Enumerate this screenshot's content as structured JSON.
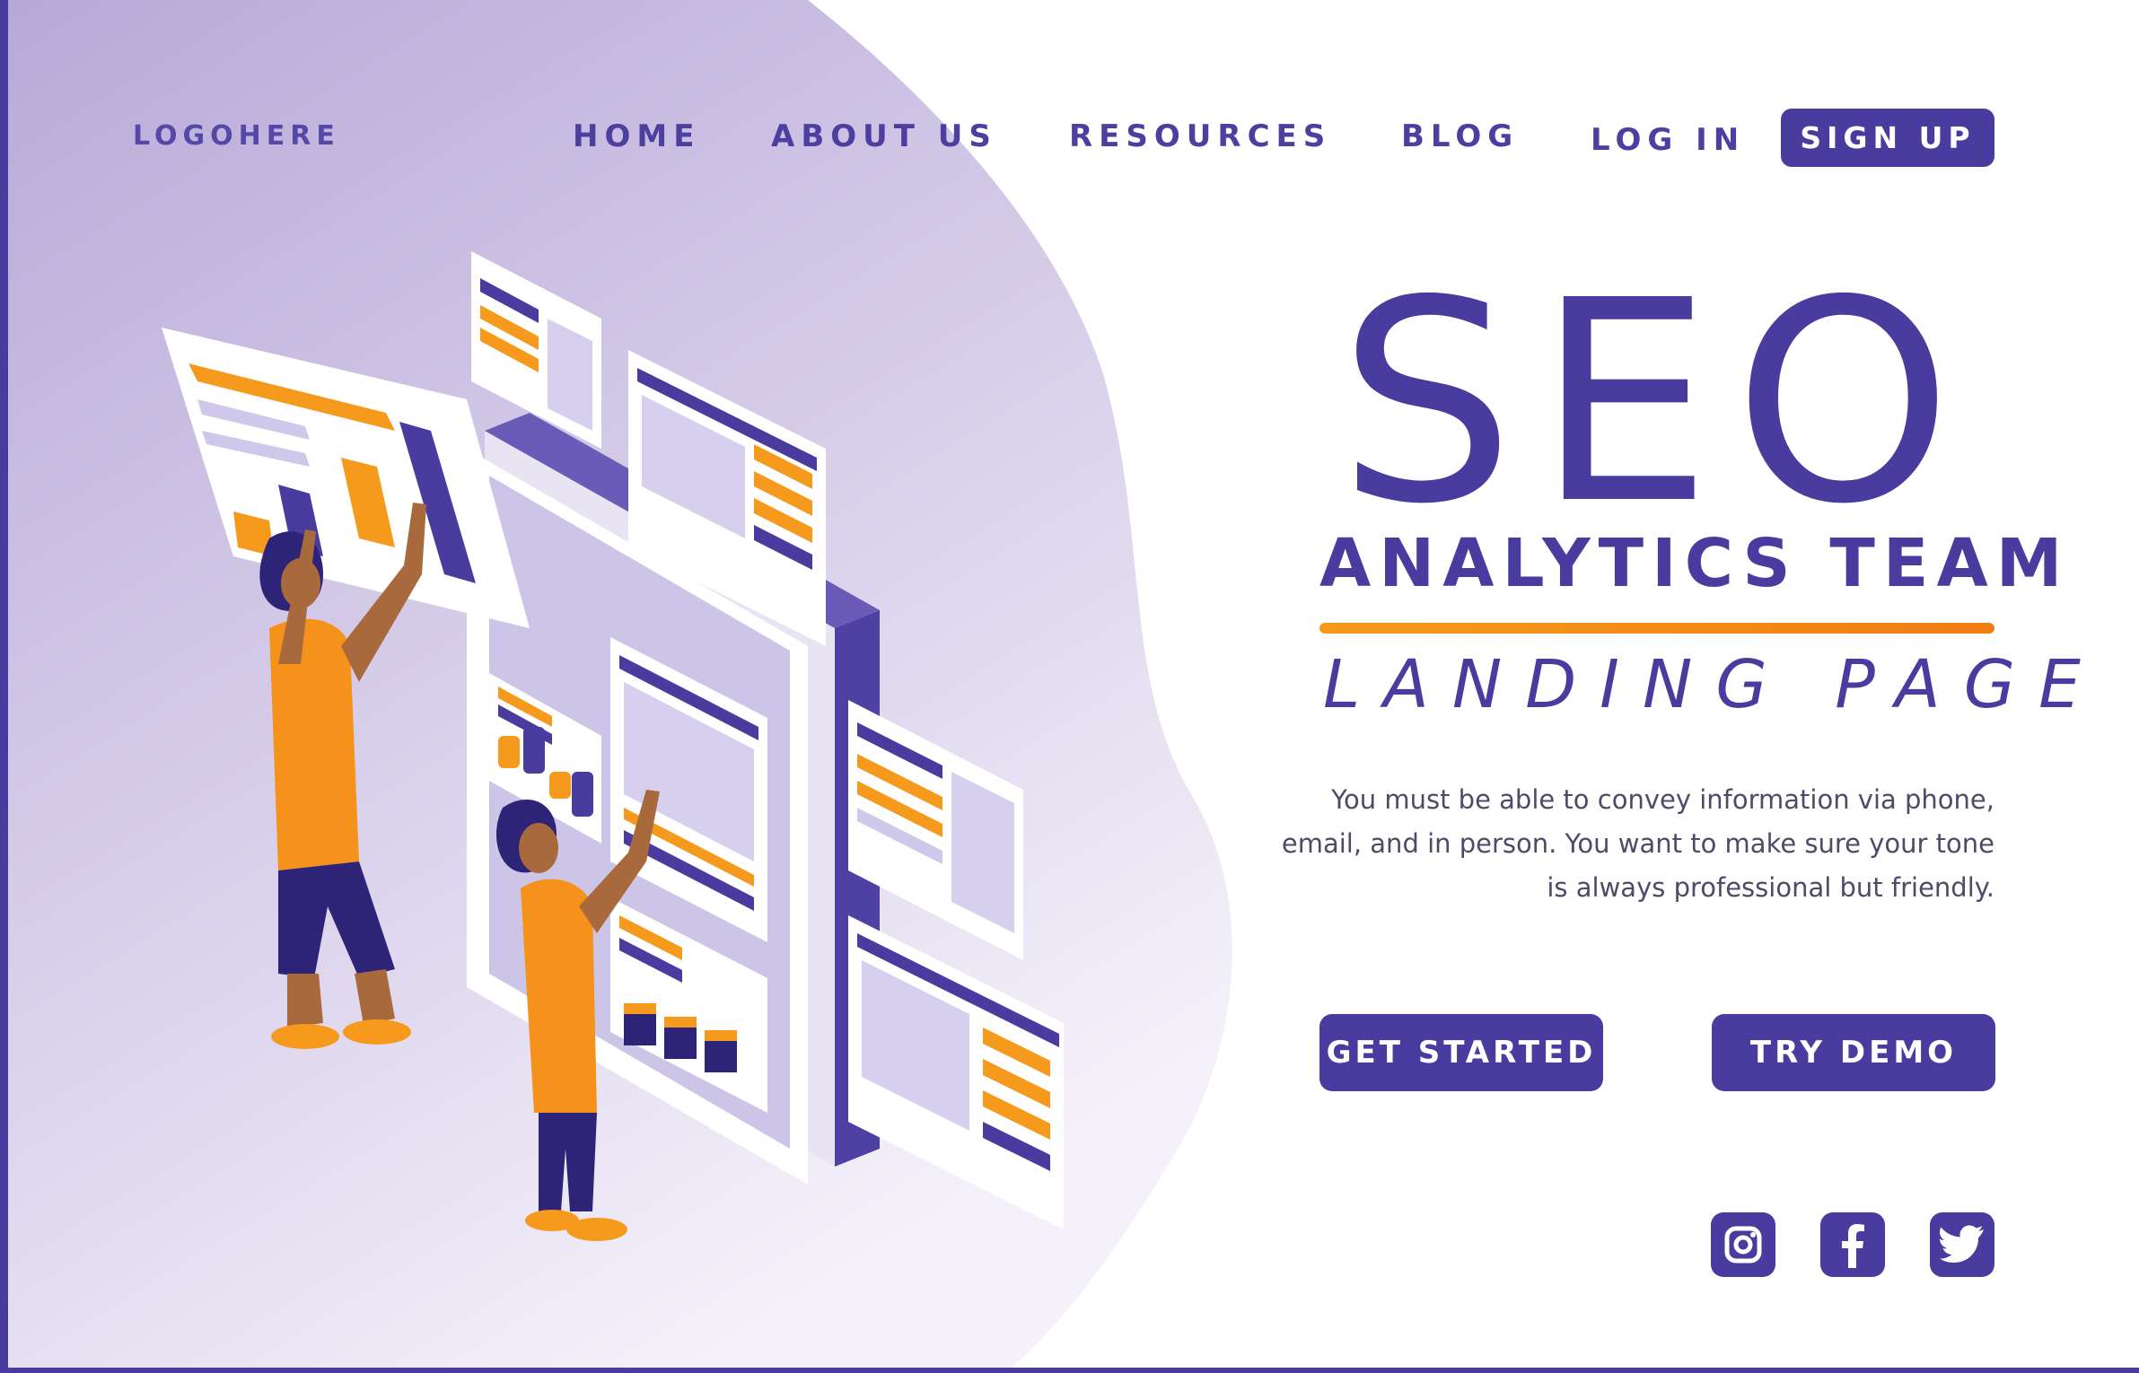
{
  "nav": {
    "logo": "LOGOHERE",
    "home": "HOME",
    "about": "ABOUT US",
    "resources": "RESOURCES",
    "blog": "BLOG",
    "login": "LOG IN",
    "signup": "SIGN UP"
  },
  "hero": {
    "title": "SEO",
    "subtitle": "ANALYTICS TEAM",
    "tagline": "LANDING PAGE",
    "description_lines": [
      "You must be able to convey information via phone,",
      "email, and in person. You want to make sure your tone",
      "is always professional but friendly."
    ]
  },
  "buttons": {
    "get_started": "GET STARTED",
    "try_demo": "TRY DEMO"
  },
  "social": [
    "instagram-icon",
    "facebook-icon",
    "twitter-icon"
  ],
  "colors": {
    "primary": "#4a3b9e",
    "accent": "#f59a1c",
    "lavender": "#c9bde3",
    "text": "#4f4a68"
  }
}
